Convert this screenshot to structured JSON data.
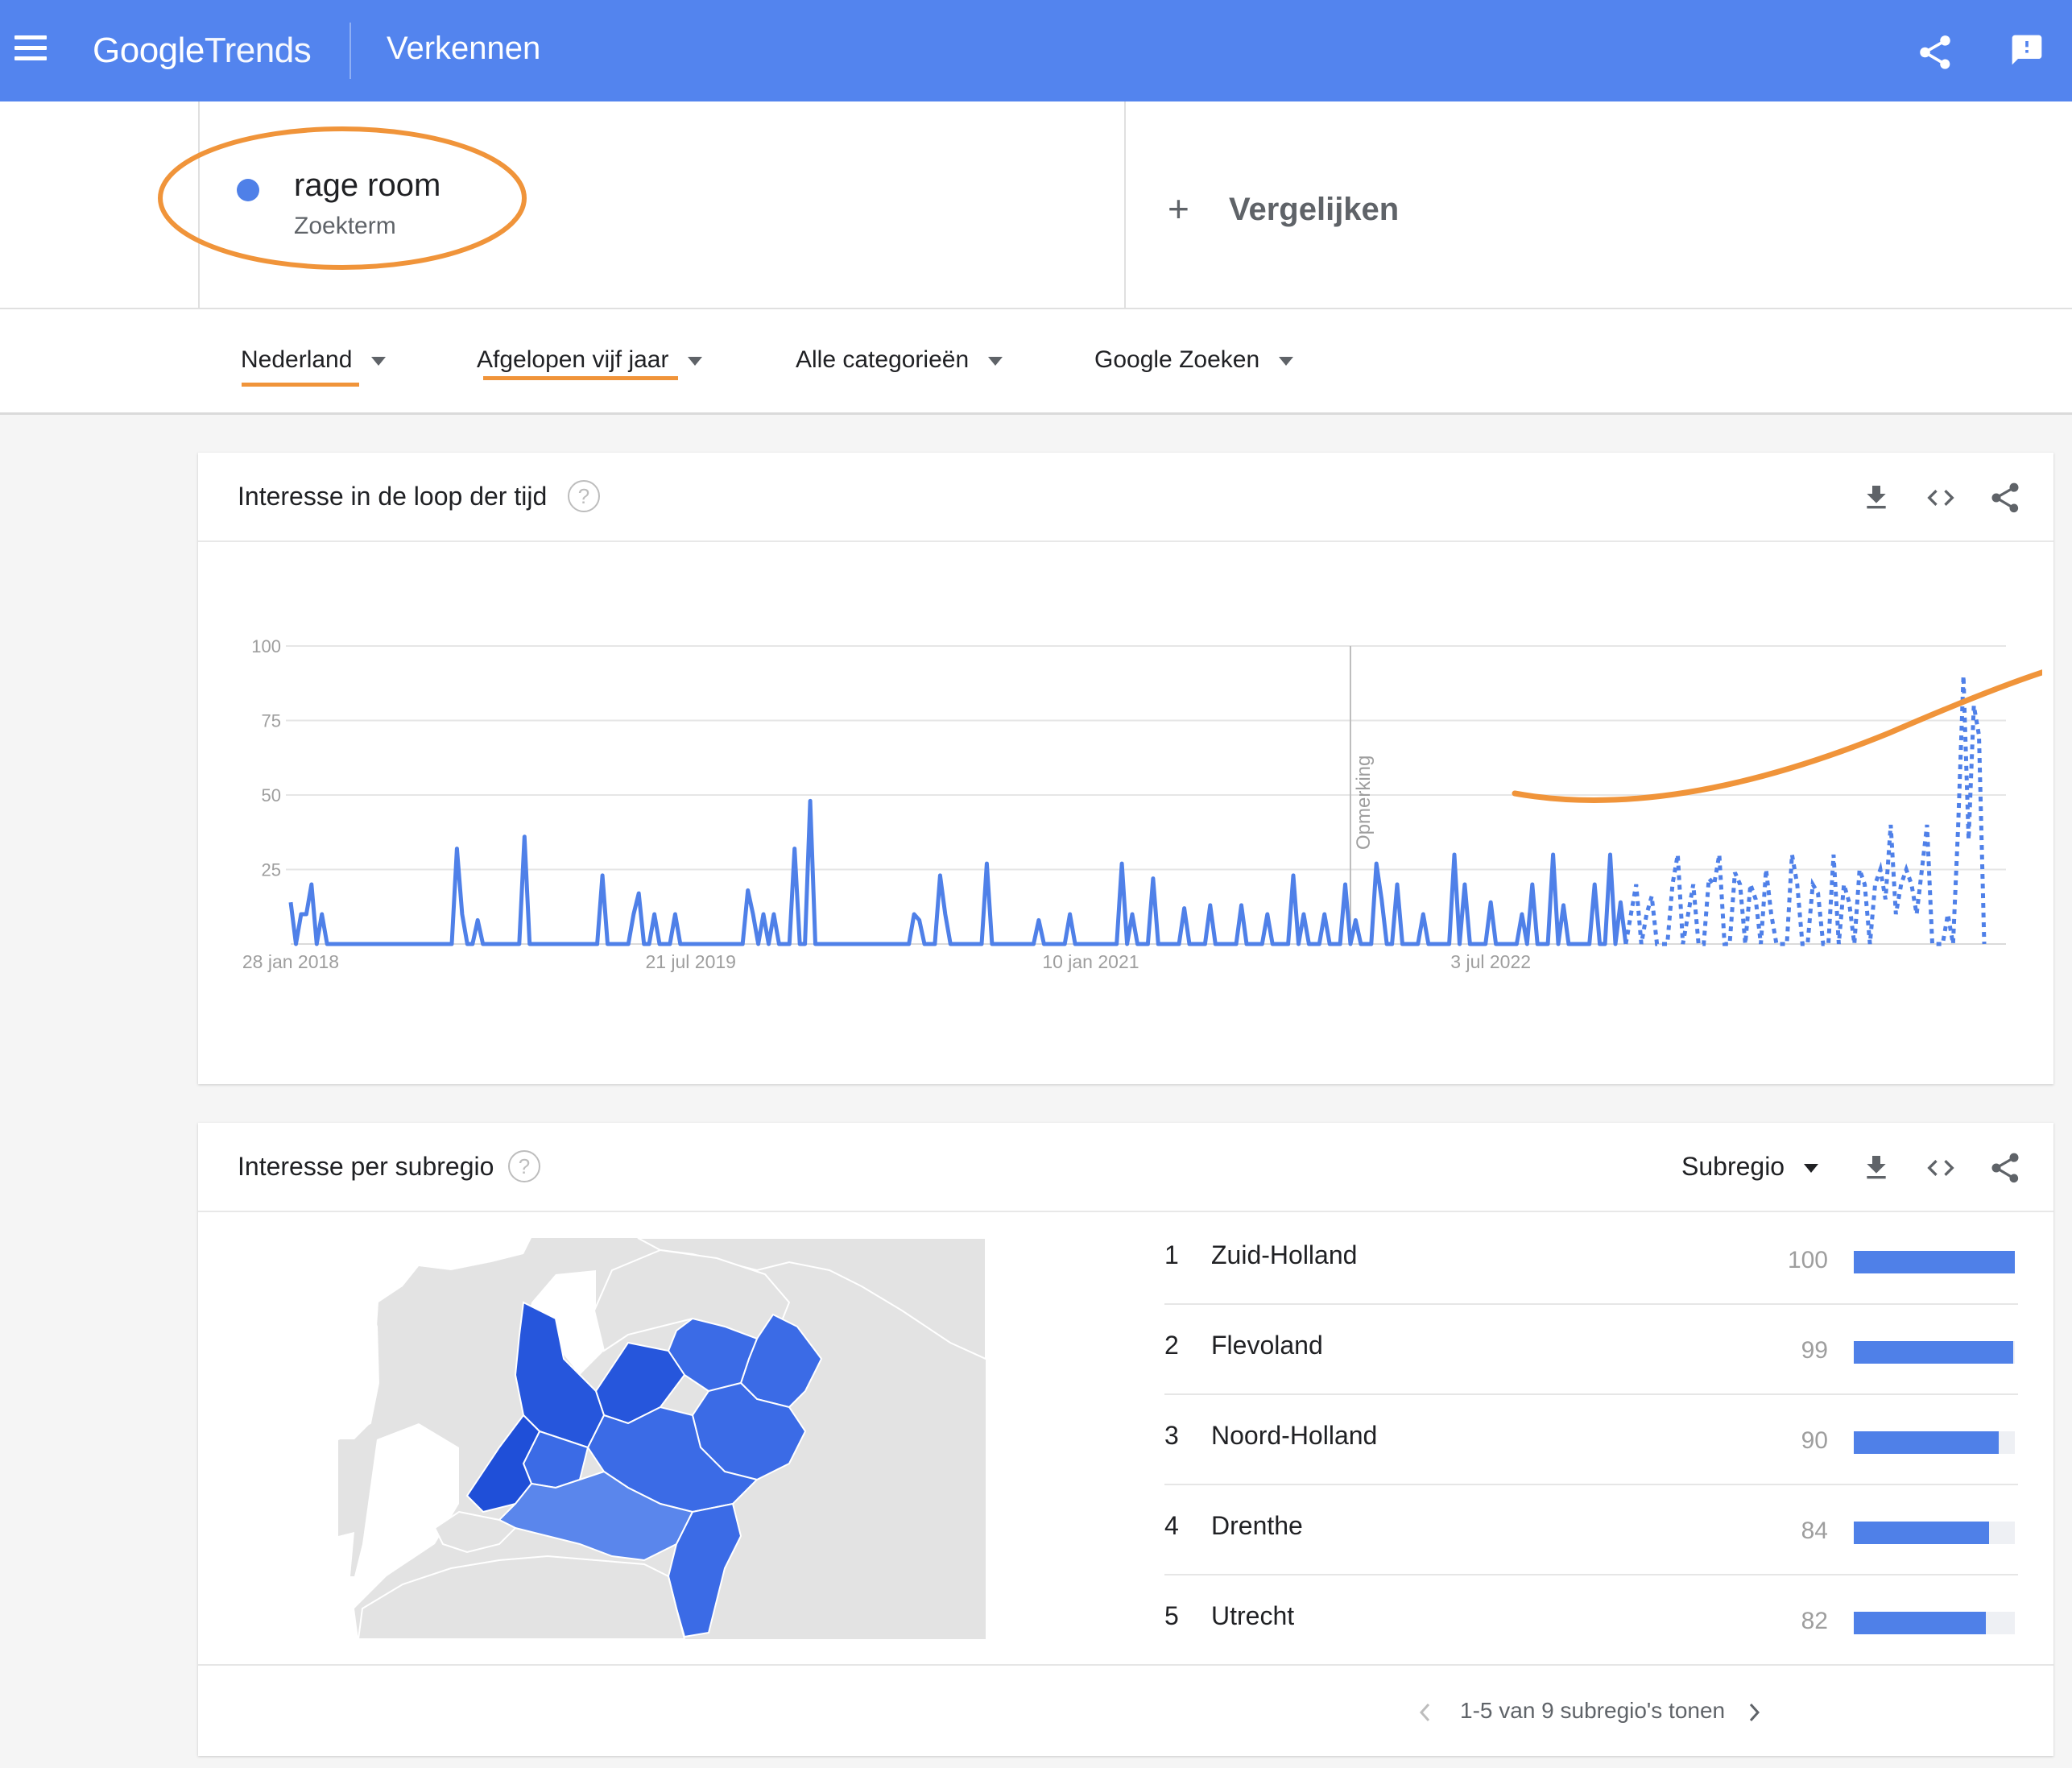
{
  "header": {
    "logo_google": "Google",
    "logo_trends": "Trends",
    "title": "Verkennen",
    "icons": [
      "menu-icon",
      "share-icon",
      "feedback-icon"
    ]
  },
  "term": {
    "name": "rage room",
    "type": "Zoekterm",
    "color": "#4f80e8",
    "compare_plus": "+",
    "compare_label": "Vergelijken"
  },
  "filters": [
    {
      "label": "Nederland"
    },
    {
      "label": "Afgelopen vijf jaar"
    },
    {
      "label": "Alle categorieën"
    },
    {
      "label": "Google Zoeken"
    }
  ],
  "annotation_color": "#f0943a",
  "time_card": {
    "title": "Interesse in de loop der tijd",
    "help": "?",
    "annotation_label": "Opmerking",
    "icons": [
      "download-icon",
      "embed-icon",
      "share-icon"
    ]
  },
  "chart_data": {
    "type": "line",
    "title": "Interesse in de loop der tijd",
    "xlabel": "",
    "ylabel": "",
    "ylim": [
      0,
      100
    ],
    "yticks": [
      100,
      75,
      50,
      25
    ],
    "xtick_labels": [
      "28 jan 2018",
      "21 jul 2019",
      "10 jan 2021",
      "3 jul 2022"
    ],
    "xtick_index": [
      0,
      77,
      154,
      231
    ],
    "grid": true,
    "annotation_index": 204,
    "partial_from_index": 257,
    "series": [
      {
        "color": "#4f80e8",
        "values": [
          14,
          0,
          10,
          10,
          20,
          0,
          10,
          0,
          0,
          0,
          0,
          0,
          0,
          0,
          0,
          0,
          0,
          0,
          0,
          0,
          0,
          0,
          0,
          0,
          0,
          0,
          0,
          0,
          0,
          0,
          0,
          0,
          32,
          10,
          0,
          0,
          8,
          0,
          0,
          0,
          0,
          0,
          0,
          0,
          0,
          36,
          0,
          0,
          0,
          0,
          0,
          0,
          0,
          0,
          0,
          0,
          0,
          0,
          0,
          0,
          23,
          0,
          0,
          0,
          0,
          0,
          10,
          17,
          0,
          0,
          10,
          0,
          0,
          0,
          10,
          0,
          0,
          0,
          0,
          0,
          0,
          0,
          0,
          0,
          0,
          0,
          0,
          0,
          18,
          10,
          0,
          10,
          0,
          10,
          0,
          0,
          0,
          32,
          0,
          0,
          48,
          0,
          0,
          0,
          0,
          0,
          0,
          0,
          0,
          0,
          0,
          0,
          0,
          0,
          0,
          0,
          0,
          0,
          0,
          0,
          10,
          8,
          0,
          0,
          0,
          23,
          10,
          0,
          0,
          0,
          0,
          0,
          0,
          0,
          27,
          0,
          0,
          0,
          0,
          0,
          0,
          0,
          0,
          0,
          8,
          0,
          0,
          0,
          0,
          0,
          10,
          0,
          0,
          0,
          0,
          0,
          0,
          0,
          0,
          0,
          27,
          0,
          10,
          0,
          0,
          0,
          22,
          0,
          0,
          0,
          0,
          0,
          12,
          0,
          0,
          0,
          0,
          13,
          0,
          0,
          0,
          0,
          0,
          13,
          0,
          0,
          0,
          0,
          10,
          0,
          0,
          0,
          0,
          23,
          0,
          10,
          0,
          0,
          0,
          10,
          0,
          0,
          0,
          20,
          0,
          8,
          0,
          0,
          0,
          27,
          15,
          0,
          0,
          20,
          0,
          0,
          0,
          0,
          10,
          0,
          0,
          0,
          0,
          0,
          30,
          0,
          20,
          0,
          0,
          0,
          0,
          14,
          0,
          0,
          0,
          0,
          0,
          10,
          0,
          20,
          0,
          0,
          0,
          30,
          0,
          13,
          0,
          0,
          0,
          0,
          0,
          20,
          0,
          0,
          30,
          0,
          14,
          0,
          10,
          20,
          0,
          10,
          16,
          0,
          0,
          0,
          20,
          30,
          0,
          10,
          20,
          0,
          0,
          22,
          20,
          30,
          0,
          0,
          24,
          20,
          0,
          20,
          15,
          0,
          25,
          10,
          0,
          0,
          0,
          30,
          20,
          0,
          0,
          20,
          17,
          0,
          0,
          30,
          0,
          20,
          14,
          0,
          25,
          20,
          0,
          20,
          25,
          15,
          40,
          10,
          20,
          25,
          20,
          10,
          25,
          40,
          0,
          0,
          0,
          10,
          0,
          40,
          90,
          35,
          80,
          70,
          0
        ]
      }
    ]
  },
  "region_card": {
    "title": "Interesse per subregio",
    "help": "?",
    "dropdown": "Subregio",
    "icons": [
      "download-icon",
      "embed-icon",
      "share-icon"
    ],
    "rows": [
      {
        "rank": "1",
        "name": "Zuid-Holland",
        "value": "100",
        "fraction": 1.0
      },
      {
        "rank": "2",
        "name": "Flevoland",
        "value": "99",
        "fraction": 0.99
      },
      {
        "rank": "3",
        "name": "Noord-Holland",
        "value": "90",
        "fraction": 0.9
      },
      {
        "rank": "4",
        "name": "Drenthe",
        "value": "84",
        "fraction": 0.84
      },
      {
        "rank": "5",
        "name": "Utrecht",
        "value": "82",
        "fraction": 0.82
      }
    ],
    "pager_text": "1-5 van 9 subregio's tonen",
    "map_colors": {
      "background": "#e3e3e3",
      "high": "#2656dc",
      "mid": "#3b6be6",
      "low": "#5a86ec",
      "border": "#ffffff"
    }
  }
}
